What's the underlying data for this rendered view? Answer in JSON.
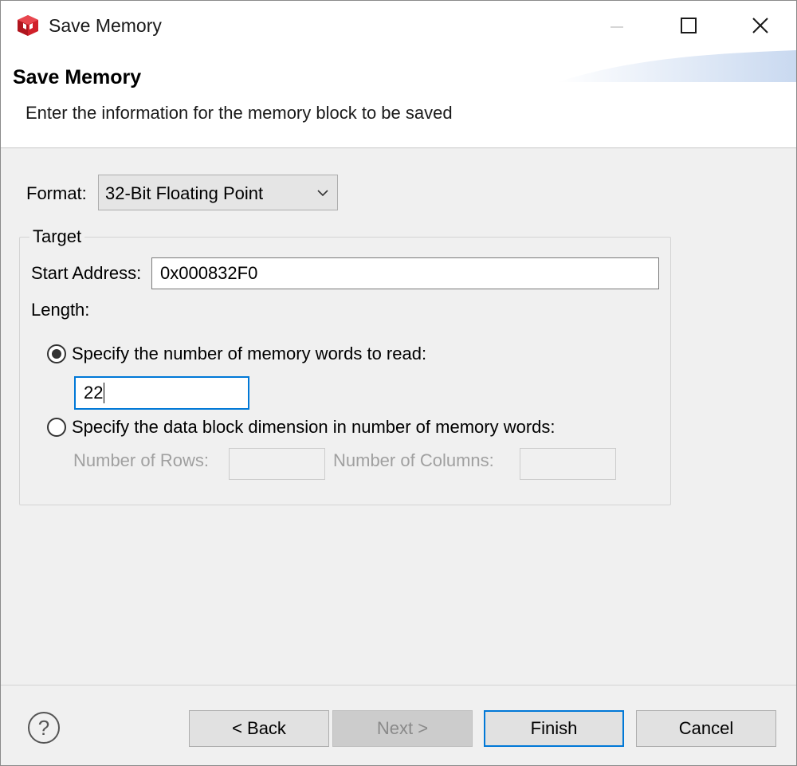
{
  "window": {
    "title": "Save Memory",
    "app_icon": "red-cube-icon",
    "controls": [
      "minimize-icon",
      "maximize-icon",
      "close-icon"
    ]
  },
  "banner": {
    "title": "Save Memory",
    "description": "Enter the information for the memory block to be saved"
  },
  "form": {
    "format_label": "Format:",
    "format_value": "32-Bit Floating Point",
    "group_title": "Target",
    "start_address_label": "Start Address:",
    "start_address_value": "0x000832F0",
    "length_label": "Length:",
    "option_words_label": "Specify the number of memory words to read:",
    "option_words_selected": true,
    "words_value": "22",
    "option_block_label": "Specify the data block dimension in number of memory words:",
    "option_block_selected": false,
    "rows_label": "Number of Rows:",
    "rows_value": "",
    "columns_label": "Number of Columns:",
    "columns_value": ""
  },
  "footer": {
    "help_icon": "help-icon",
    "help_glyph": "?",
    "back_label": "< Back",
    "next_label": "Next >",
    "finish_label": "Finish",
    "cancel_label": "Cancel"
  },
  "colors": {
    "focus_accent": "#0078d7",
    "icon_red": "#d0202a"
  }
}
